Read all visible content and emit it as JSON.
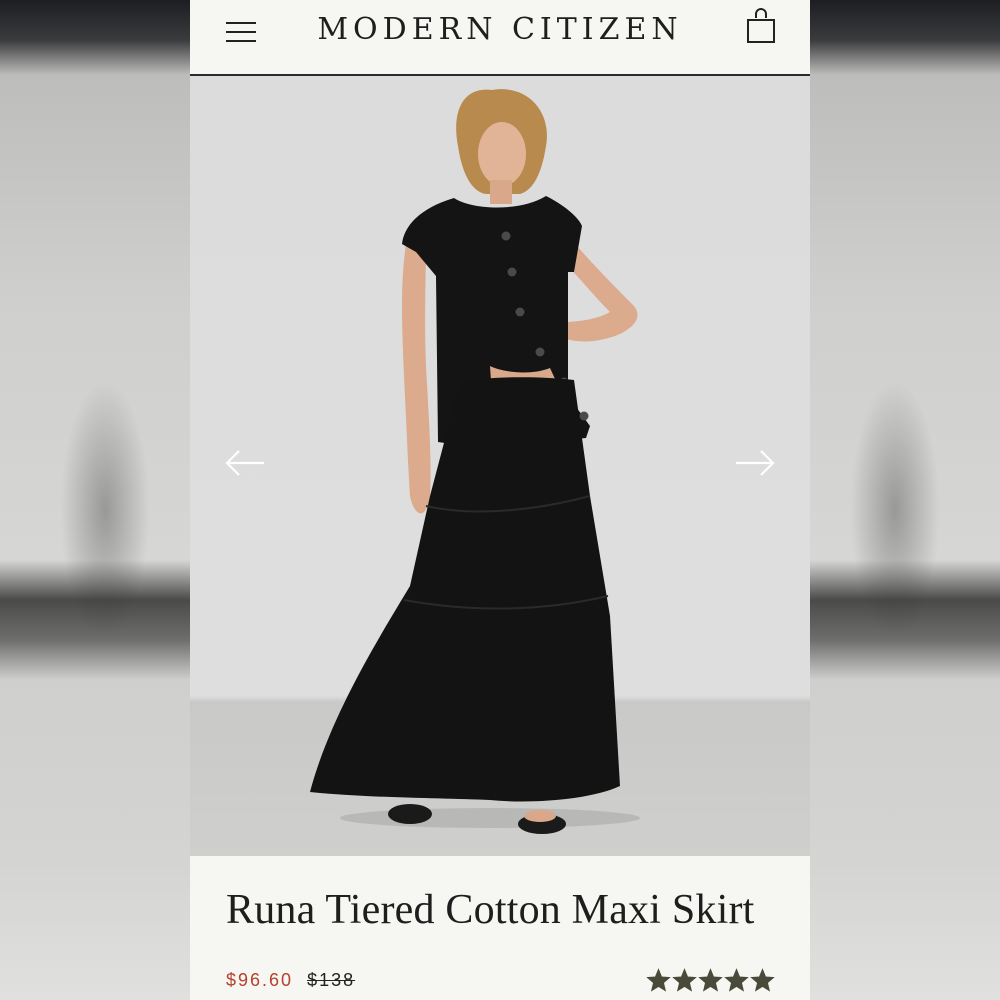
{
  "header": {
    "brand": "MODERN CITIZEN",
    "icons": {
      "menu": "hamburger-menu-icon",
      "bag": "shopping-bag-icon"
    }
  },
  "gallery": {
    "image": "model in black cap-sleeve button top and black tiered maxi skirt",
    "icons": {
      "prev": "arrow-left-icon",
      "next": "arrow-right-icon"
    }
  },
  "product": {
    "title": "Runa Tiered Cotton Maxi Skirt",
    "sale_price": "$96.60",
    "original_price": "$138",
    "rating": 5,
    "rating_max": 5
  },
  "colors": {
    "accent_sale": "#b5402b",
    "star": "#4a4a3a",
    "text": "#1e1e1e",
    "background": "#f6f6f3"
  }
}
